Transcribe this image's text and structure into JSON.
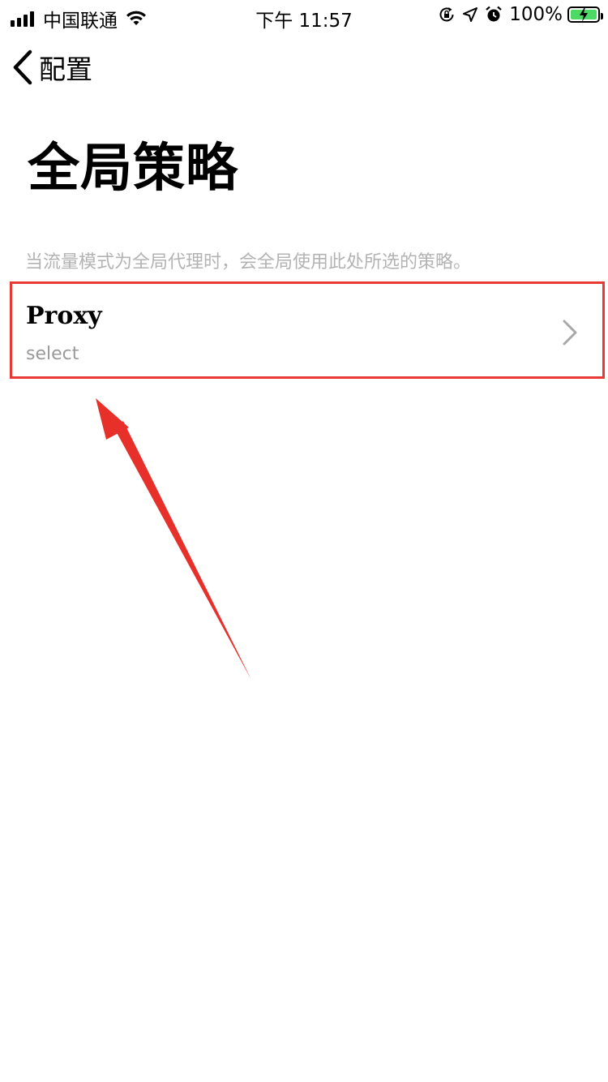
{
  "status_bar": {
    "carrier": "中国联通",
    "time": "下午 11:57",
    "battery_percent": "100%",
    "icons": [
      "signal-icon",
      "wifi-icon",
      "rotation-lock-icon",
      "location-icon",
      "alarm-icon",
      "battery-charging-icon"
    ]
  },
  "nav": {
    "back_label": "配置",
    "back_icon": "chevron-left-icon"
  },
  "page": {
    "title": "全局策略",
    "description": "当流量模式为全局代理时，会全局使用此处所选的策略。"
  },
  "policy_row": {
    "title": "Proxy",
    "subtitle": "select",
    "icon": "chevron-right-icon"
  },
  "colors": {
    "highlight_border": "#e83a35",
    "annotation_arrow": "#e8302b",
    "secondary_text": "#b3b3b3",
    "battery_fill": "#4cd964"
  }
}
